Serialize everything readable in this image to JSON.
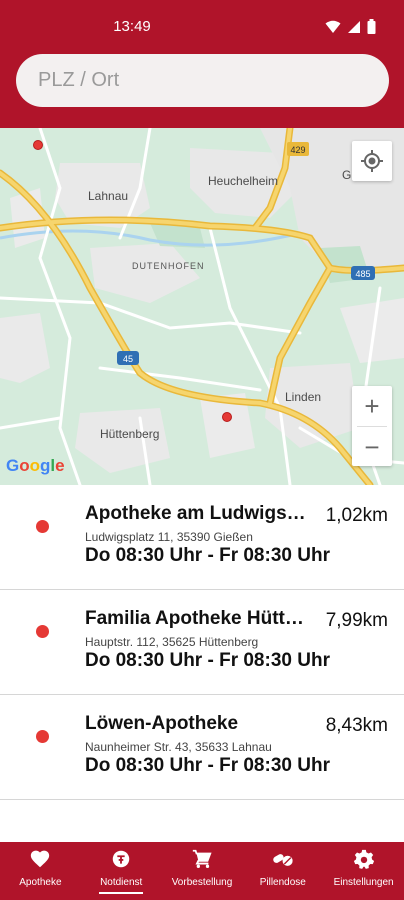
{
  "status_bar": {
    "time": "13:49"
  },
  "search": {
    "placeholder": "PLZ / Ort",
    "value": ""
  },
  "map": {
    "place_labels": {
      "lahnau": "Lahnau",
      "heuchelheim": "Heuchelheim",
      "giessen": "Gießen",
      "dutenhofen": "DUTENHOFEN",
      "linden": "Linden",
      "huettenberg": "Hüttenberg"
    },
    "road_shields": {
      "b429": "429",
      "a485": "485",
      "a45": "45"
    },
    "zoom_in_label": "+",
    "zoom_out_label": "−",
    "attribution": [
      "G",
      "o",
      "o",
      "g",
      "l",
      "e"
    ],
    "colors": {
      "land": "#d7ece0",
      "forest": "#c5e4cf",
      "urban": "#eaeaea",
      "highway": "#f0c64a",
      "water": "#aad3ef"
    }
  },
  "pharmacies": [
    {
      "name": "Apotheke am Ludwigsplatz",
      "distance": "1,02km",
      "address": "Ludwigsplatz 11, 35390 Gießen",
      "hours": "Do 08:30 Uhr - Fr 08:30 Uhr"
    },
    {
      "name": "Familia Apotheke Hüttenberg",
      "distance": "7,99km",
      "address": "Hauptstr. 112, 35625 Hüttenberg",
      "hours": "Do 08:30 Uhr - Fr 08:30 Uhr"
    },
    {
      "name": "Löwen-Apotheke",
      "distance": "8,43km",
      "address": "Naunheimer Str. 43, 35633 Lahnau",
      "hours": "Do 08:30 Uhr - Fr 08:30 Uhr"
    }
  ],
  "bottom_nav": [
    {
      "label": "Apotheke",
      "icon": "heart-icon"
    },
    {
      "label": "Notdienst",
      "icon": "cross-circle-icon",
      "active": true
    },
    {
      "label": "Vorbestellung",
      "icon": "cart-icon"
    },
    {
      "label": "Pillendose",
      "icon": "pills-icon"
    },
    {
      "label": "Einstellungen",
      "icon": "gear-icon"
    }
  ],
  "theme": {
    "brand_red": "#b0142a",
    "marker_red": "#e53935"
  }
}
